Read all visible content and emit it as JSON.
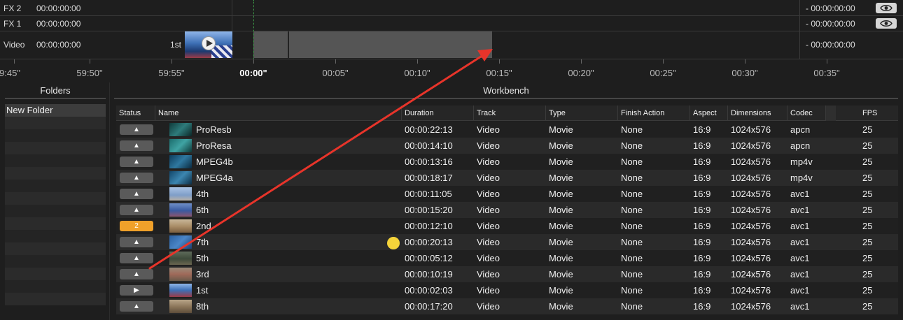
{
  "colors": {
    "background": "#1e1e1e",
    "clip": "#555555",
    "status_badge_orange": "#f0a12a",
    "status_badge_gray": "#5a5a5a",
    "playhead": "#3fa34a",
    "annotation_arrow": "#e8342a",
    "cursor_dot": "#f5d43a"
  },
  "timeline": {
    "tracks": [
      {
        "name": "FX 2",
        "timecode": "00:00:00:00",
        "right_timecode": "- 00:00:00:00",
        "visibility_icon": "eye-icon"
      },
      {
        "name": "FX 1",
        "timecode": "00:00:00:00",
        "right_timecode": "- 00:00:00:00",
        "visibility_icon": "eye-icon"
      },
      {
        "name": "Video",
        "timecode": "00:00:00:00",
        "right_timecode": "- 00:00:00:00"
      }
    ],
    "clip_label": "1st",
    "ruler": [
      "9:45\"",
      "59:50\"",
      "59:55\"",
      "00:00\"",
      "00:05\"",
      "00:10\"",
      "00:15\"",
      "00:20\"",
      "00:25\"",
      "00:30\"",
      "00:35\""
    ]
  },
  "folders": {
    "title": "Folders",
    "items": [
      "New Folder"
    ]
  },
  "workbench": {
    "title": "Workbench",
    "columns": [
      "Status",
      "Name",
      "Duration",
      "Track",
      "Type",
      "Finish Action",
      "Aspect",
      "Dimensions",
      "Codec",
      "FPS"
    ],
    "rows": [
      {
        "status": "▲",
        "name": "ProResb",
        "duration": "00:00:22:13",
        "track": "Video",
        "type": "Movie",
        "finish": "None",
        "aspect": "16:9",
        "dimensions": "1024x576",
        "codec": "apcn",
        "fps": "25"
      },
      {
        "status": "▲",
        "name": "ProResa",
        "duration": "00:00:14:10",
        "track": "Video",
        "type": "Movie",
        "finish": "None",
        "aspect": "16:9",
        "dimensions": "1024x576",
        "codec": "apcn",
        "fps": "25"
      },
      {
        "status": "▲",
        "name": "MPEG4b",
        "duration": "00:00:13:16",
        "track": "Video",
        "type": "Movie",
        "finish": "None",
        "aspect": "16:9",
        "dimensions": "1024x576",
        "codec": "mp4v",
        "fps": "25"
      },
      {
        "status": "▲",
        "name": "MPEG4a",
        "duration": "00:00:18:17",
        "track": "Video",
        "type": "Movie",
        "finish": "None",
        "aspect": "16:9",
        "dimensions": "1024x576",
        "codec": "mp4v",
        "fps": "25"
      },
      {
        "status": "▲",
        "name": "4th",
        "duration": "00:00:11:05",
        "track": "Video",
        "type": "Movie",
        "finish": "None",
        "aspect": "16:9",
        "dimensions": "1024x576",
        "codec": "avc1",
        "fps": "25"
      },
      {
        "status": "▲",
        "name": "6th",
        "duration": "00:00:15:20",
        "track": "Video",
        "type": "Movie",
        "finish": "None",
        "aspect": "16:9",
        "dimensions": "1024x576",
        "codec": "avc1",
        "fps": "25"
      },
      {
        "status": "2",
        "name": "2nd",
        "duration": "00:00:12:10",
        "track": "Video",
        "type": "Movie",
        "finish": "None",
        "aspect": "16:9",
        "dimensions": "1024x576",
        "codec": "avc1",
        "fps": "25"
      },
      {
        "status": "▲",
        "name": "7th",
        "duration": "00:00:20:13",
        "track": "Video",
        "type": "Movie",
        "finish": "None",
        "aspect": "16:9",
        "dimensions": "1024x576",
        "codec": "avc1",
        "fps": "25"
      },
      {
        "status": "▲",
        "name": "5th",
        "duration": "00:00:05:12",
        "track": "Video",
        "type": "Movie",
        "finish": "None",
        "aspect": "16:9",
        "dimensions": "1024x576",
        "codec": "avc1",
        "fps": "25"
      },
      {
        "status": "▲",
        "name": "3rd",
        "duration": "00:00:10:19",
        "track": "Video",
        "type": "Movie",
        "finish": "None",
        "aspect": "16:9",
        "dimensions": "1024x576",
        "codec": "avc1",
        "fps": "25"
      },
      {
        "status": "▶",
        "name": "1st",
        "duration": "00:00:02:03",
        "track": "Video",
        "type": "Movie",
        "finish": "None",
        "aspect": "16:9",
        "dimensions": "1024x576",
        "codec": "avc1",
        "fps": "25"
      },
      {
        "status": "▲",
        "name": "8th",
        "duration": "00:00:17:20",
        "track": "Video",
        "type": "Movie",
        "finish": "None",
        "aspect": "16:9",
        "dimensions": "1024x576",
        "codec": "avc1",
        "fps": "25"
      }
    ]
  }
}
